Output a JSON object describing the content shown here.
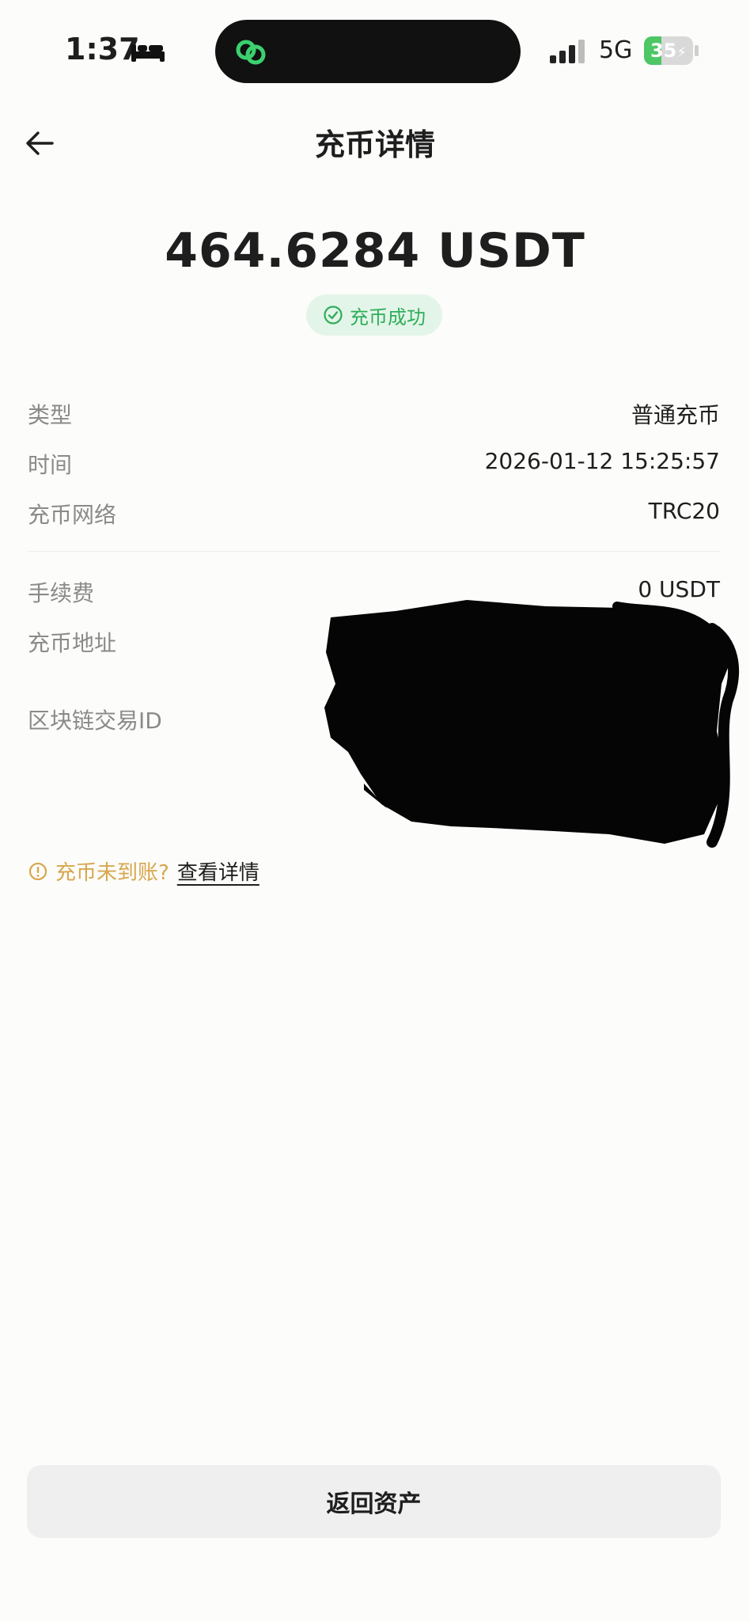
{
  "status_bar": {
    "time": "1:37",
    "network": "5G",
    "battery": "35",
    "battery_level": 0.35,
    "icons": [
      "bed-icon",
      "link-icon",
      "signal-icon",
      "charging-icon"
    ]
  },
  "header": {
    "title": "充币详情",
    "back_icon": "arrow-left-icon"
  },
  "summary": {
    "amount": "464.6284 USDT",
    "status": "充币成功",
    "status_color": "#2fae5b"
  },
  "details": {
    "type_label": "类型",
    "type_value": "普通充币",
    "time_label": "时间",
    "time_value": "2026-01-12 15:25:57",
    "network_label": "充币网络",
    "network_value": "TRC20",
    "fee_label": "手续费",
    "fee_value": "0 USDT",
    "address_label": "充币地址",
    "txid_label": "区块链交易ID"
  },
  "notice": {
    "text": "充币未到账?",
    "link": "查看详情",
    "color": "#d8a64c"
  },
  "footer": {
    "button_label": "返回资产"
  }
}
